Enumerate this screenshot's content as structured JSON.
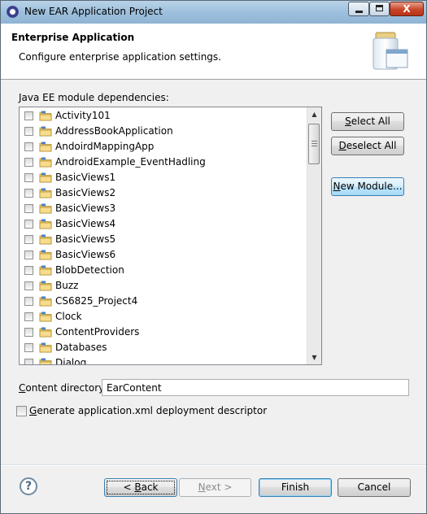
{
  "window": {
    "title": "New EAR Application Project",
    "minimize_glyph": "",
    "maximize_glyph": "",
    "close_glyph": "X"
  },
  "header": {
    "title": "Enterprise Application",
    "subtitle": "Configure enterprise application settings.",
    "icon": "jar-wizard-icon"
  },
  "dependencies": {
    "label": "Java EE module dependencies:",
    "items": [
      {
        "label": "Activity101",
        "checked": false
      },
      {
        "label": "AddressBookApplication",
        "checked": false
      },
      {
        "label": "AndoirdMappingApp",
        "checked": false
      },
      {
        "label": "AndroidExample_EventHadling",
        "checked": false
      },
      {
        "label": "BasicViews1",
        "checked": false
      },
      {
        "label": "BasicViews2",
        "checked": false
      },
      {
        "label": "BasicViews3",
        "checked": false
      },
      {
        "label": "BasicViews4",
        "checked": false
      },
      {
        "label": "BasicViews5",
        "checked": false
      },
      {
        "label": "BasicViews6",
        "checked": false
      },
      {
        "label": "BlobDetection",
        "checked": false
      },
      {
        "label": "Buzz",
        "checked": false
      },
      {
        "label": "CS6825_Project4",
        "checked": false
      },
      {
        "label": "Clock",
        "checked": false
      },
      {
        "label": "ContentProviders",
        "checked": false
      },
      {
        "label": "Databases",
        "checked": false
      },
      {
        "label": "Dialog",
        "checked": false
      }
    ]
  },
  "side_buttons": {
    "select_all_pre": "",
    "select_all_key": "S",
    "select_all_post": "elect All",
    "deselect_all_pre": "",
    "deselect_all_key": "D",
    "deselect_all_post": "eselect All",
    "new_module_pre": "",
    "new_module_key": "N",
    "new_module_post": "ew Module..."
  },
  "content_directory": {
    "label_pre": "",
    "label_key": "C",
    "label_post": "ontent directory:",
    "value": "EarContent"
  },
  "generate_descriptor": {
    "label_pre": "",
    "label_key": "G",
    "label_post": "enerate application.xml deployment descriptor",
    "checked": false
  },
  "footer": {
    "help_glyph": "?",
    "back_pre": "< ",
    "back_key": "B",
    "back_post": "ack",
    "next_pre": "",
    "next_key": "N",
    "next_post": "ext >",
    "finish": "Finish",
    "cancel": "Cancel"
  }
}
